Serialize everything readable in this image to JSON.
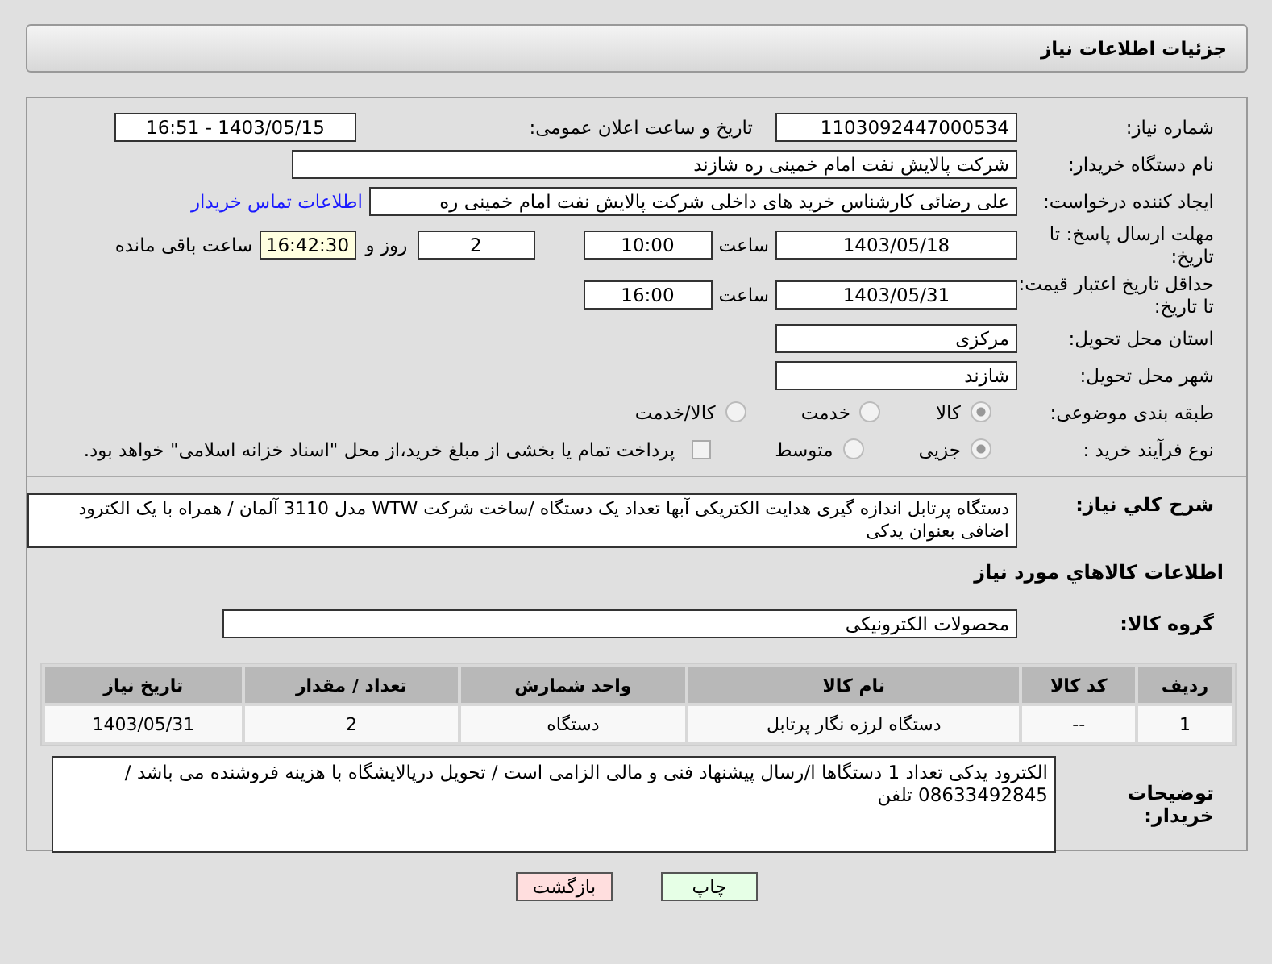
{
  "header": {
    "title": "جزئیات اطلاعات نیاز"
  },
  "fields": {
    "need_number": {
      "label": "شماره نیاز:",
      "value": "1103092447000534"
    },
    "announce": {
      "label": "تاریخ و ساعت اعلان عمومی:",
      "value": "1403/05/15 - 16:51"
    },
    "buyer_org": {
      "label": "نام دستگاه خریدار:",
      "value": "شرکت پالایش نفت امام خمینی  ره  شازند"
    },
    "requester": {
      "label": "ایجاد کننده درخواست:",
      "value": "علی  رضائی کارشناس خرید های داخلی  شرکت پالایش نفت امام خمینی  ره",
      "link": "اطلاعات تماس خریدار"
    },
    "deadline": {
      "label": "مهلت ارسال پاسخ: تا تاریخ:",
      "date": "1403/05/18",
      "time_label": "ساعت",
      "time": "10:00",
      "days": "2",
      "days_label": "روز و",
      "remaining": "16:42:30",
      "remaining_label": "ساعت باقی مانده"
    },
    "validity": {
      "label": "حداقل تاریخ اعتبار قیمت: تا تاریخ:",
      "date": "1403/05/31",
      "time_label": "ساعت",
      "time": "16:00"
    },
    "province": {
      "label": "استان محل تحویل:",
      "value": "مرکزی"
    },
    "city": {
      "label": "شهر محل تحویل:",
      "value": "شازند"
    },
    "category": {
      "label": "طبقه بندی موضوعی:",
      "options": [
        {
          "label": "کالا",
          "selected": true
        },
        {
          "label": "خدمت",
          "selected": false
        },
        {
          "label": "کالا/خدمت",
          "selected": false
        }
      ]
    },
    "process": {
      "label": "نوع فرآیند خرید :",
      "options": [
        {
          "label": "جزیی",
          "selected": true
        },
        {
          "label": "متوسط",
          "selected": false
        }
      ],
      "payment": {
        "checked": false,
        "text": "پرداخت تمام یا بخشی از مبلغ خرید،از محل \"اسناد خزانه اسلامی\" خواهد بود."
      }
    }
  },
  "description": {
    "label": "شرح کلي نياز:",
    "value": "دستگاه پرتابل اندازه گیری هدایت الکتریکی آبها   تعداد یک دستگاه /ساخت شرکت WTW مدل 3110 آلمان  / همراه با یک الکترود اضافی  بعنوان یدکی"
  },
  "goods_heading": "اطلاعات کالاهاي مورد نياز",
  "goods_group": {
    "label": "گروه کالا:",
    "value": "محصولات الکترونیکی"
  },
  "table": {
    "columns": [
      "ردیف",
      "کد کالا",
      "نام کالا",
      "واحد شمارش",
      "تعداد / مقدار",
      "تاریخ نیاز"
    ],
    "rows": [
      [
        "1",
        "--",
        "دستگاه لرزه نگار پرتابل",
        "دستگاه",
        "2",
        "1403/05/31"
      ]
    ]
  },
  "buyer_notes": {
    "label": "توضیحات خریدار:",
    "value": "الکترود یدکی تعداد 1 دستگاها ا/رسال پیشنهاد فنی و مالی الزامی است / تحویل درپالایشگاه با هزینه فروشنده می باشد / 08633492845 تلفن"
  },
  "buttons": [
    {
      "label": "چاپ",
      "kind": "print"
    },
    {
      "label": "بازگشت",
      "kind": "back"
    }
  ]
}
